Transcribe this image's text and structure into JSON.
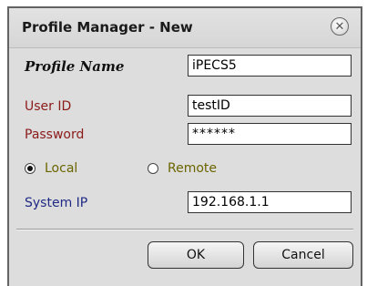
{
  "dialog": {
    "title": "Profile Manager - New",
    "close_icon": "close-icon"
  },
  "form": {
    "profile_name_label": "Profile Name",
    "profile_name_value": "iPECS5",
    "user_id_label": "User ID",
    "user_id_value": "testID",
    "password_label": "Password",
    "password_value": "******",
    "radio_local_label": "Local",
    "radio_remote_label": "Remote",
    "selected_mode": "Local",
    "system_ip_label": "System IP",
    "system_ip_value": "192.168.1.1"
  },
  "buttons": {
    "ok_label": "OK",
    "cancel_label": "Cancel"
  },
  "colors": {
    "red_label": "#8b1a1a",
    "blue_label": "#1f2a85",
    "radio_text": "#6b6500",
    "dialog_bg": "#dddddd"
  }
}
